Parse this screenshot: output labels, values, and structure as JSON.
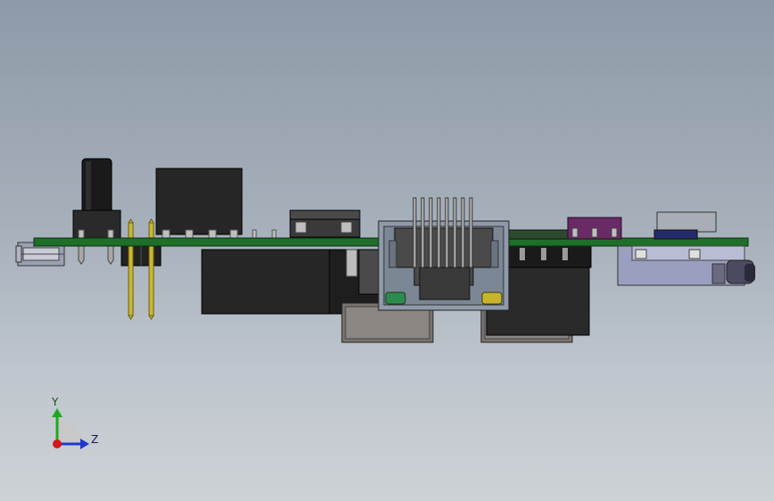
{
  "view": {
    "background_top": "#8e9aa8",
    "background_bottom": "#cdd2d6"
  },
  "triad": {
    "y_label": "Y",
    "z_label": "Z",
    "y_color": "#1fa81f",
    "z_color": "#2038d0",
    "x_color": "#d01818"
  },
  "pcb": {
    "color": "#1f6e2a"
  },
  "rj45": {
    "pin_count": 8,
    "led_left_color": "#2e8b4f",
    "led_right_color": "#c8b42a"
  },
  "header_pins": {
    "color": "#c9b832"
  },
  "purple_component": {
    "color": "#6a2a66"
  }
}
